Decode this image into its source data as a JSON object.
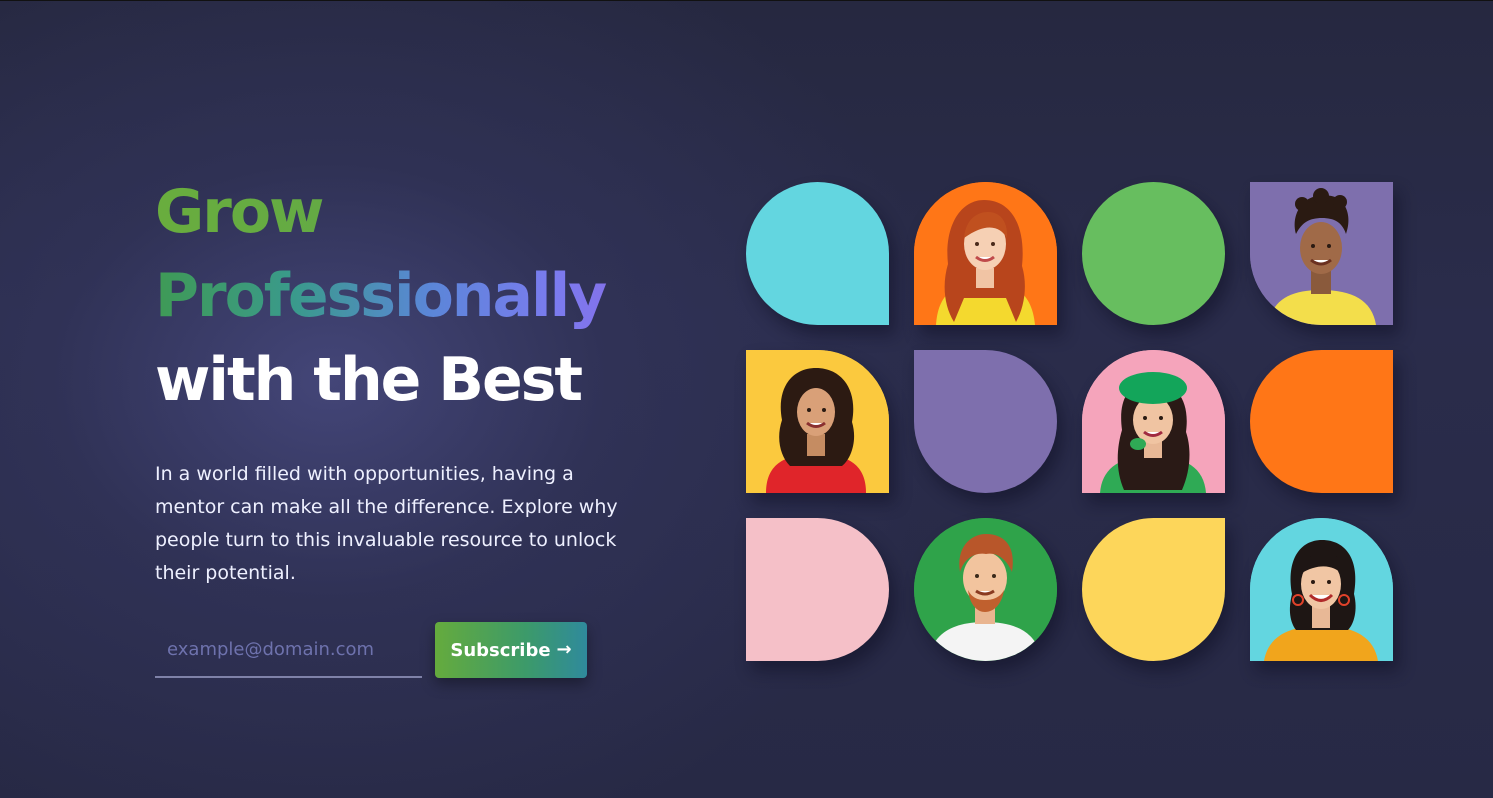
{
  "hero": {
    "line1": "Grow",
    "line2": "Professionally",
    "line3": "with the Best",
    "description": "In a world filled with opportunities, having a mentor can make all the difference. Explore why people turn to this invaluable resource to unlock their potential."
  },
  "subscribe": {
    "placeholder": "example@domain.com",
    "button_label": "Subscribe",
    "button_icon": "arrow-right-icon",
    "arrow": "→"
  },
  "colors": {
    "background": "#282a47",
    "accent_green": "#65ab3d",
    "accent_teal": "#2f8a9c",
    "accent_purple": "#8a6be6",
    "tile_cyan": "#63d6e0",
    "tile_orange": "#ff7617",
    "tile_green": "#67be5f",
    "tile_purple": "#7e6fad",
    "tile_yellow": "#fdd65a",
    "tile_pink": "#f5c0c8"
  },
  "tiles": [
    {
      "kind": "color",
      "color": "cyan"
    },
    {
      "kind": "photo",
      "subject": "red-haired woman",
      "bg": "orange"
    },
    {
      "kind": "color",
      "color": "green"
    },
    {
      "kind": "photo",
      "subject": "young man with curly hair",
      "bg": "purple"
    },
    {
      "kind": "photo",
      "subject": "curly-haired woman",
      "bg": "yellow"
    },
    {
      "kind": "color",
      "color": "purple"
    },
    {
      "kind": "photo",
      "subject": "woman in green beret",
      "bg": "pink"
    },
    {
      "kind": "color",
      "color": "orange"
    },
    {
      "kind": "color",
      "color": "pink"
    },
    {
      "kind": "photo",
      "subject": "red-haired man",
      "bg": "green"
    },
    {
      "kind": "color",
      "color": "yellow"
    },
    {
      "kind": "photo",
      "subject": "smiling woman",
      "bg": "cyan"
    }
  ]
}
